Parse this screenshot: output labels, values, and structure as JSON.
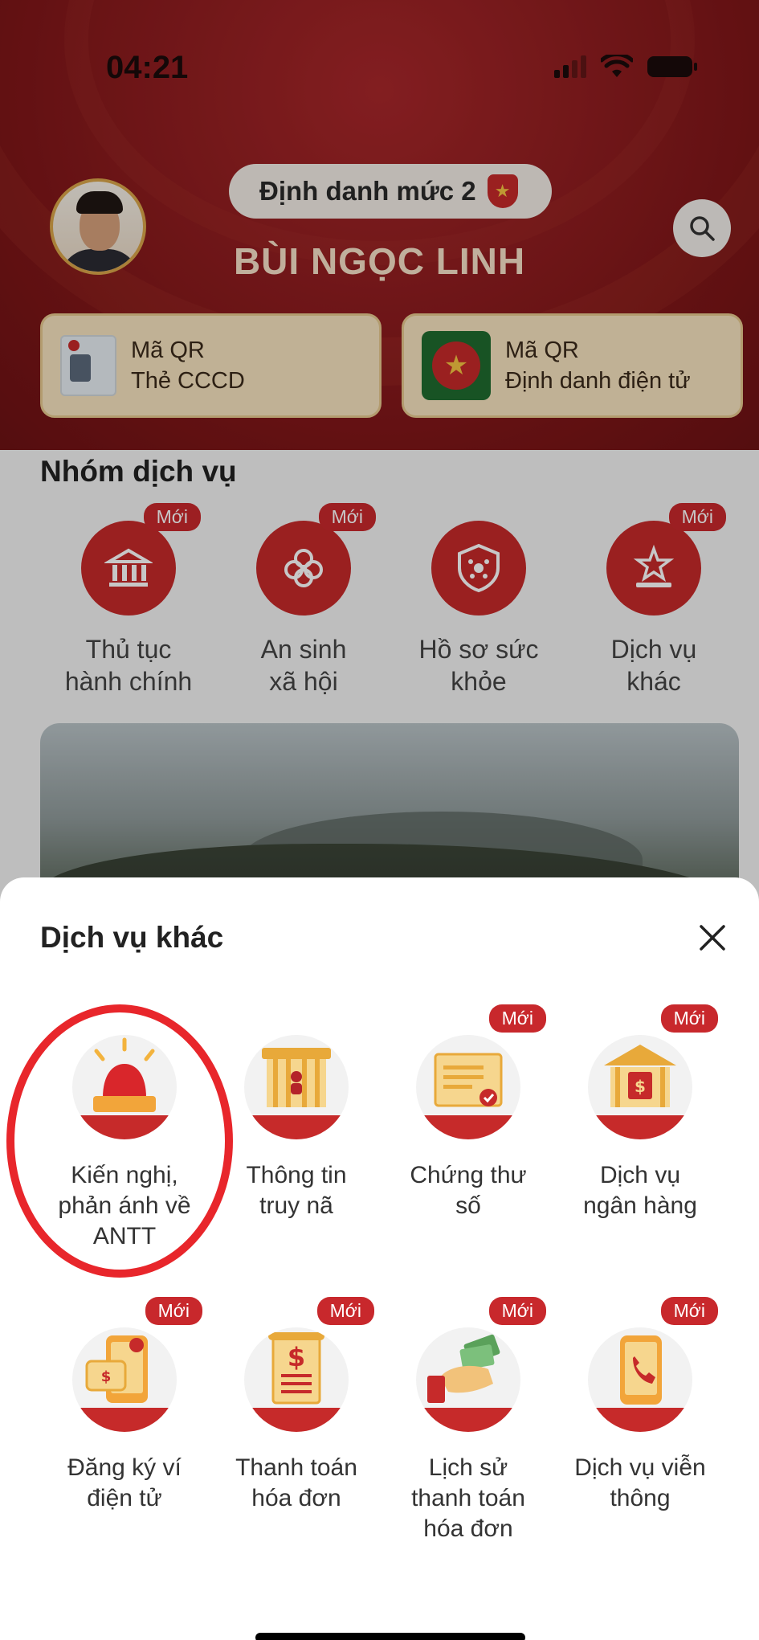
{
  "status": {
    "time": "04:21"
  },
  "header": {
    "level_label": "Định danh mức 2",
    "user_name": "BÙI NGỌC LINH",
    "qr_cards": [
      {
        "line1": "Mã QR",
        "line2": "Thẻ CCCD"
      },
      {
        "line1": "Mã QR",
        "line2": "Định danh điện tử"
      }
    ]
  },
  "services_group": {
    "title": "Nhóm dịch vụ",
    "items": [
      {
        "line1": "Thủ tục",
        "line2": "hành chính",
        "badge": "Mới",
        "icon": "government-building-icon"
      },
      {
        "line1": "An sinh",
        "line2": "xã hội",
        "badge": "Mới",
        "icon": "flower-emblem-icon"
      },
      {
        "line1": "Hồ sơ sức",
        "line2": "khỏe",
        "badge": "",
        "icon": "health-shield-icon"
      },
      {
        "line1": "Dịch vụ",
        "line2": "khác",
        "badge": "Mới",
        "icon": "star-podium-icon"
      }
    ]
  },
  "sheet": {
    "title": "Dịch vụ khác",
    "items": [
      {
        "lines": [
          "Kiến nghị,",
          "phản ánh về",
          "ANTT"
        ],
        "badge": "",
        "icon": "siren-icon"
      },
      {
        "lines": [
          "Thông tin",
          "truy nã"
        ],
        "badge": "",
        "icon": "prison-bars-icon"
      },
      {
        "lines": [
          "Chứng thư",
          "số"
        ],
        "badge": "Mới",
        "icon": "certificate-icon"
      },
      {
        "lines": [
          "Dịch vụ",
          "ngân hàng"
        ],
        "badge": "Mới",
        "icon": "bank-icon"
      },
      {
        "lines": [
          "Đăng ký ví",
          "điện tử"
        ],
        "badge": "Mới",
        "icon": "e-wallet-icon"
      },
      {
        "lines": [
          "Thanh toán",
          "hóa đơn"
        ],
        "badge": "Mới",
        "icon": "bill-icon"
      },
      {
        "lines": [
          "Lịch sử",
          "thanh toán",
          "hóa đơn"
        ],
        "badge": "Mới",
        "icon": "payment-history-icon"
      },
      {
        "lines": [
          "Dịch vụ viễn",
          "thông"
        ],
        "badge": "Mới",
        "icon": "phone-call-icon"
      }
    ]
  },
  "colors": {
    "brand_red": "#c62a2a",
    "header_red": "#8e1b1d",
    "badge_red": "#c8282c",
    "highlight_red": "#e8262b"
  }
}
